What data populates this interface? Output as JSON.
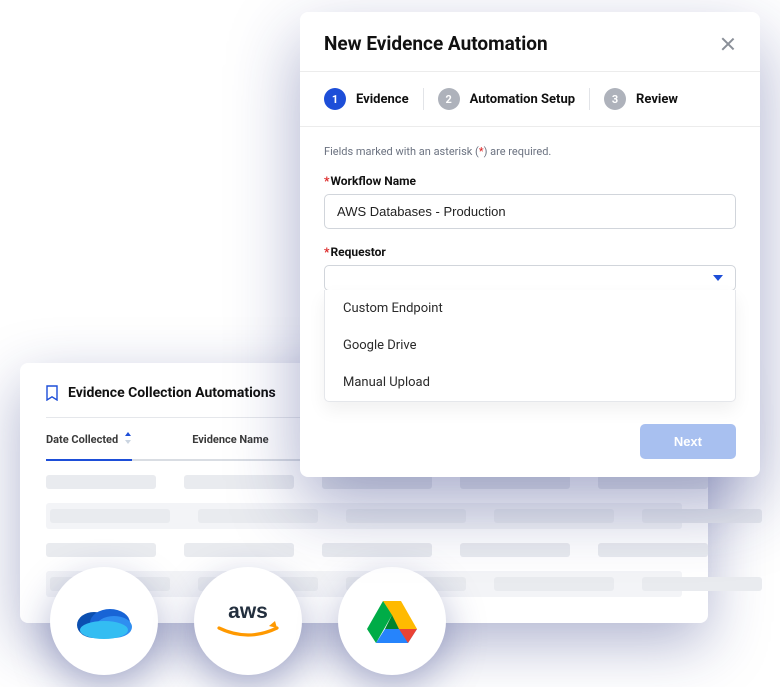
{
  "background": {
    "title": "Evidence Collection Automations",
    "columns": [
      "Date Collected",
      "Evidence Name"
    ]
  },
  "modal": {
    "title": "New Evidence Automation",
    "stepper": [
      {
        "num": "1",
        "label": "Evidence",
        "active": true
      },
      {
        "num": "2",
        "label": "Automation Setup",
        "active": false
      },
      {
        "num": "3",
        "label": "Review",
        "active": false
      }
    ],
    "hint_prefix": "Fields marked with an asterisk (",
    "hint_ast": "*",
    "hint_suffix": ") are required.",
    "fields": {
      "workflow_name_label": "Workflow Name",
      "workflow_name_value": "AWS Databases - Production",
      "requestor_label": "Requestor",
      "requestor_value": "",
      "requestor_options": [
        "Custom Endpoint",
        "Google Drive",
        "Manual Upload"
      ]
    },
    "next_label": "Next"
  },
  "brands": [
    "onedrive",
    "aws",
    "google-drive"
  ]
}
